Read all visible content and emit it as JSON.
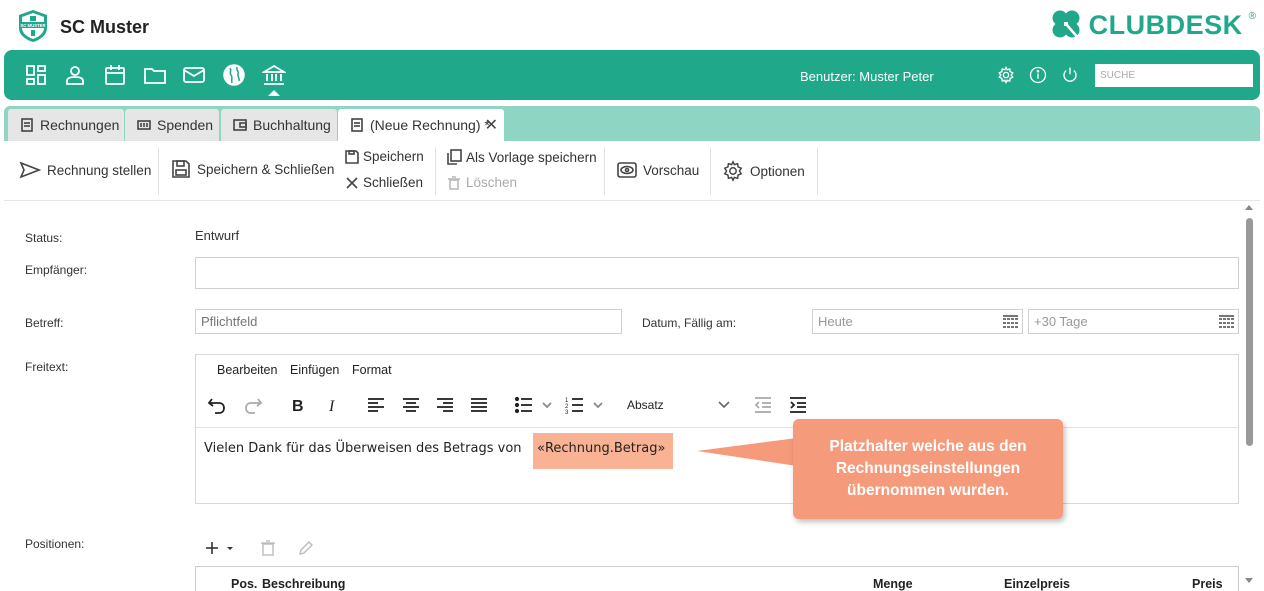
{
  "header": {
    "club_logo_text": "SC MUSTER",
    "club_name": "SC Muster",
    "brand_name": "CLUBDESK",
    "brand_mark": "®"
  },
  "nav": {
    "icons": [
      "dashboard-icon",
      "person-icon",
      "calendar-icon",
      "folder-icon",
      "mail-icon",
      "globe-icon",
      "bank-icon"
    ],
    "user_label": "Benutzer: Muster Peter",
    "right_icons": [
      "gear-icon",
      "info-icon",
      "power-icon"
    ],
    "search_placeholder": "SUCHE"
  },
  "tabs": [
    {
      "label": "Rechnungen",
      "icon": "invoice-icon"
    },
    {
      "label": "Spenden",
      "icon": "donation-icon"
    },
    {
      "label": "Buchhaltung",
      "icon": "wallet-icon"
    },
    {
      "label": "(Neue Rechnung) *",
      "icon": "invoice-icon",
      "active": true
    }
  ],
  "toolbar": {
    "send": "Rechnung stellen",
    "save_close": "Speichern & Schließen",
    "save": "Speichern",
    "close": "Schließen",
    "save_template": "Als Vorlage speichern",
    "delete": "Löschen",
    "preview": "Vorschau",
    "options": "Optionen"
  },
  "form": {
    "status_label": "Status:",
    "status_value": "Entwurf",
    "recipient_label": "Empfänger:",
    "recipient_value": "",
    "subject_label": "Betreff:",
    "subject_placeholder": "Pflichtfeld",
    "date_label": "Datum, Fällig am:",
    "date_placeholder": "Heute",
    "due_placeholder": "+30 Tage",
    "freetext_label": "Freitext:",
    "positions_label": "Positionen:"
  },
  "editor": {
    "menu": [
      "Bearbeiten",
      "Einfügen",
      "Format"
    ],
    "block_format": "Absatz",
    "text": "Vielen Dank für das Überweisen des Betrags von",
    "placeholder": "«Rechnung.Betrag»"
  },
  "callout": {
    "text": "Platzhalter welche aus den Rechnungseinstellungen übernommen wurden.",
    "color": "#f59a7b"
  },
  "positions_table": {
    "columns": [
      "Pos.",
      "Beschreibung",
      "Menge",
      "Einzelpreis",
      "Preis"
    ]
  },
  "colors": {
    "accent": "#1fa98a",
    "tab_strip": "#8fd5c3",
    "placeholder_highlight": "#f9b394"
  }
}
